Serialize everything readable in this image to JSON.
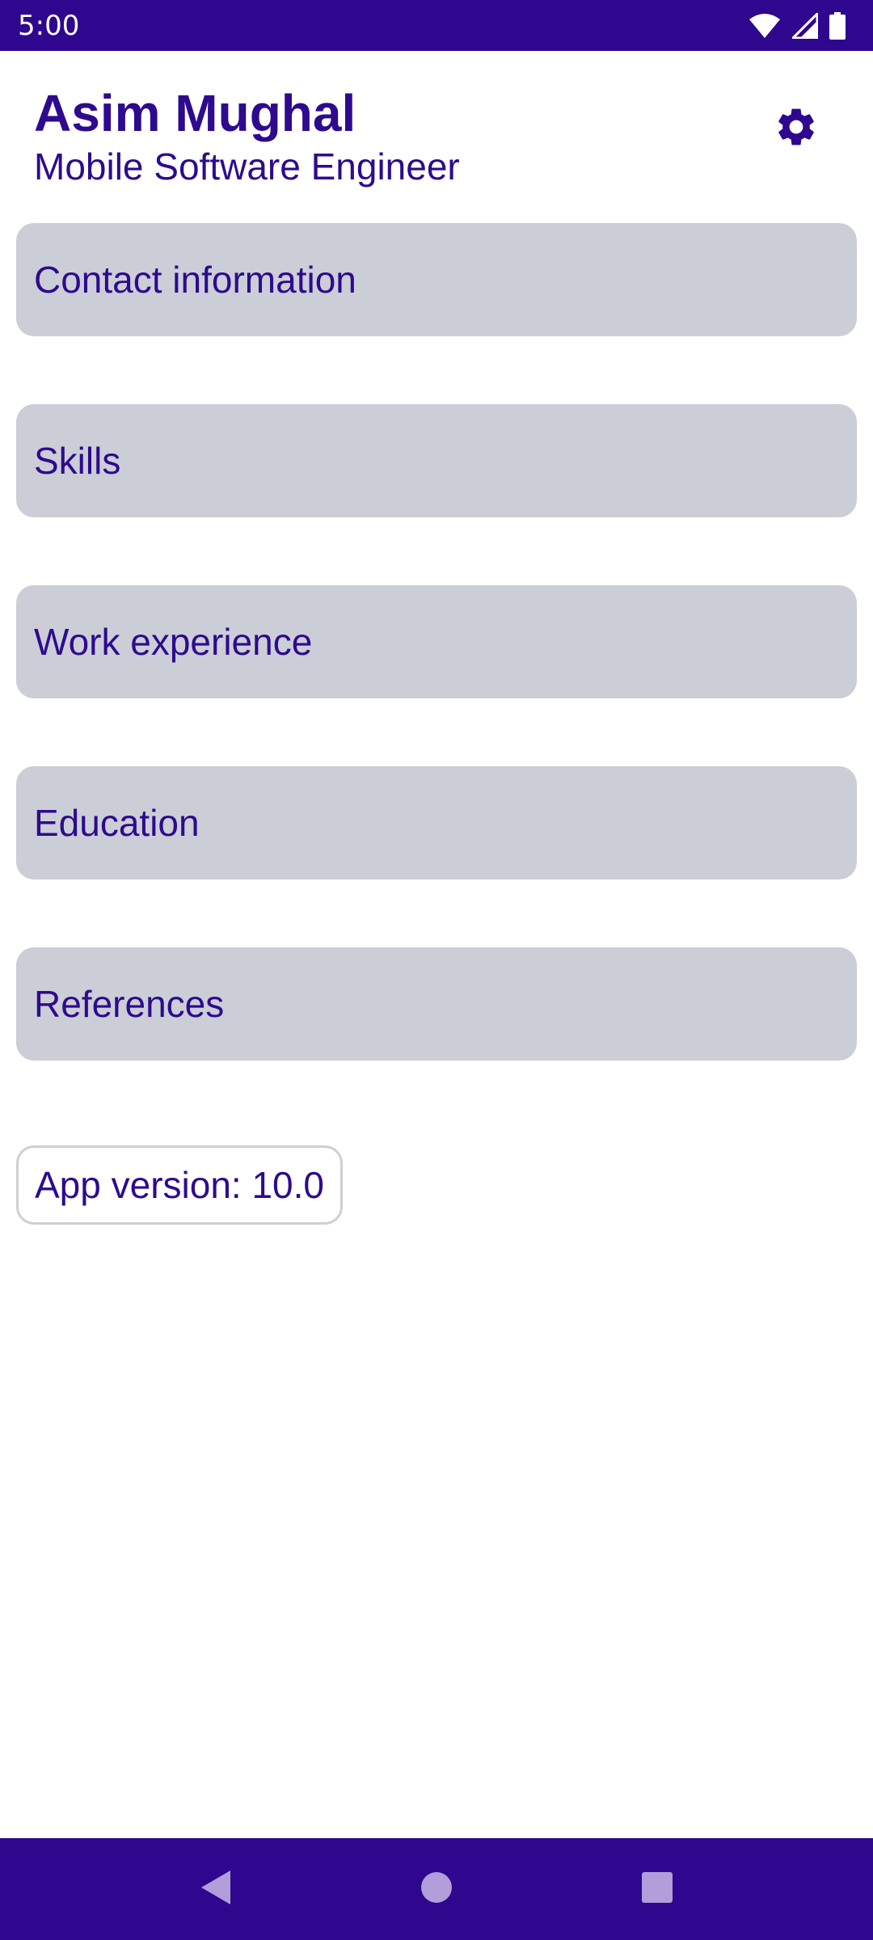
{
  "status_bar": {
    "time": "5:00",
    "icons": [
      "wifi-icon",
      "signal-icon",
      "battery-icon"
    ]
  },
  "header": {
    "name": "Asim Mughal",
    "subtitle": "Mobile Software Engineer",
    "settings_icon": "gear-icon"
  },
  "sections": [
    {
      "label": "Contact information"
    },
    {
      "label": "Skills"
    },
    {
      "label": "Work experience"
    },
    {
      "label": "Education"
    },
    {
      "label": "References"
    }
  ],
  "version": {
    "label": "App version: 10.0"
  },
  "nav_bar": {
    "icons": [
      "back-icon",
      "home-icon",
      "recents-icon"
    ]
  },
  "colors": {
    "primary": "#2e078e",
    "text_accent": "#2e0a8e",
    "card_background": "#cbced7",
    "nav_icon": "#b39ddb"
  }
}
